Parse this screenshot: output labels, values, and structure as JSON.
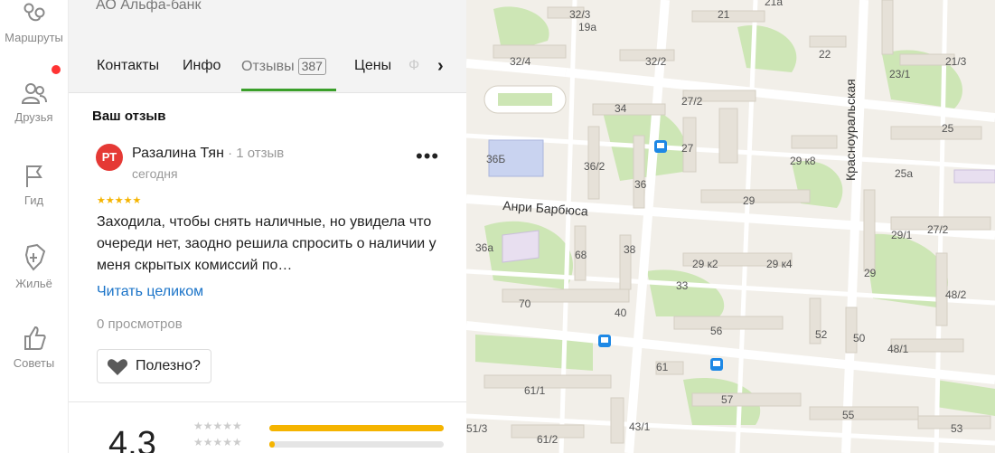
{
  "sidebar": {
    "items": [
      {
        "label": "Маршруты",
        "icon": "routes-icon"
      },
      {
        "label": "Друзья",
        "icon": "friends-icon"
      },
      {
        "label": "Гид",
        "icon": "flag-icon"
      },
      {
        "label": "Жильё",
        "icon": "housing-icon"
      },
      {
        "label": "Советы",
        "icon": "thumbs-up-icon"
      }
    ]
  },
  "org": {
    "name": "АО Альфа-банк"
  },
  "tabs": [
    {
      "label": "Контакты"
    },
    {
      "label": "Инфо"
    },
    {
      "label": "Отзывы",
      "count": "387",
      "active": true
    },
    {
      "label": "Цены"
    },
    {
      "label": "Ф"
    }
  ],
  "review": {
    "section_title": "Ваш отзыв",
    "avatar_initials": "РТ",
    "author": "Разалина Тян",
    "author_meta": " · 1 отзыв",
    "date": "сегодня",
    "rating": 5,
    "stars": "★★★★★",
    "text": "Заходила, чтобы снять наличные, но увидела что очереди нет, заодно решила спросить о наличии у меня скрытых комиссий по…",
    "read_more": "Читать целиком",
    "views": "0 просмотров",
    "useful_label": "Полезно?"
  },
  "summary": {
    "rating": "4,3",
    "distribution": [
      {
        "stars": "★★★★★",
        "fraction": 1.0
      },
      {
        "stars": "★★★★★",
        "fraction": 0.03
      }
    ]
  },
  "map": {
    "street_labels": [
      "Анри Барбюса",
      "Красноуральская"
    ],
    "house_numbers": [
      "32/3",
      "32/4",
      "19a",
      "32/2",
      "21",
      "21a",
      "22",
      "23/1",
      "21/3",
      "27/2",
      "34",
      "27",
      "36Б",
      "36/2",
      "36",
      "29 к8",
      "29",
      "25",
      "25a",
      "27/2",
      "36a",
      "68",
      "38",
      "29 к2",
      "29 к4",
      "29/1",
      "33",
      "29",
      "48/2",
      "70",
      "40",
      "56",
      "52",
      "50",
      "48/1",
      "61",
      "61/1",
      "57",
      "55",
      "53",
      "51/3",
      "61/2",
      "43/1"
    ],
    "colors": {
      "background": "#f2efe9",
      "road": "#ffffff",
      "green": "#cde6b5",
      "building": "#e6e1d8",
      "school": "#c9d3f0",
      "residential": "#e8dff0"
    }
  }
}
